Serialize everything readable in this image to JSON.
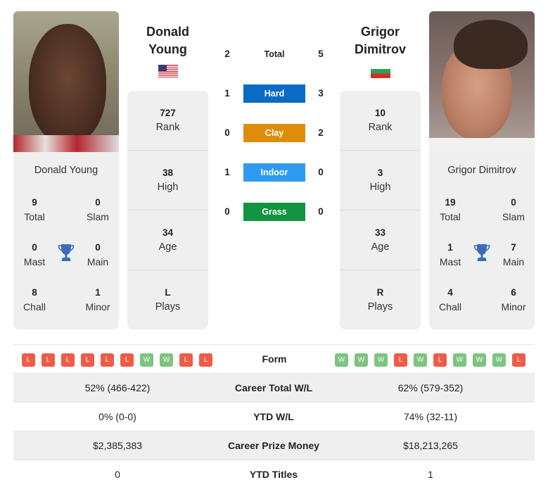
{
  "players": {
    "left": {
      "name": "Donald Young",
      "first": "Donald",
      "last": "Young",
      "country_flag": "us-flag",
      "rank": "727",
      "rank_label": "Rank",
      "high": "38",
      "high_label": "High",
      "age": "34",
      "age_label": "Age",
      "plays": "L",
      "plays_label": "Plays",
      "titles": {
        "total": "9",
        "total_label": "Total",
        "slam": "0",
        "slam_label": "Slam",
        "mast": "0",
        "mast_label": "Mast",
        "main": "0",
        "main_label": "Main",
        "chall": "8",
        "chall_label": "Chall",
        "minor": "1",
        "minor_label": "Minor"
      }
    },
    "right": {
      "name": "Grigor Dimitrov",
      "first": "Grigor",
      "last": "Dimitrov",
      "country_flag": "bulgaria-flag",
      "rank": "10",
      "rank_label": "Rank",
      "high": "3",
      "high_label": "High",
      "age": "33",
      "age_label": "Age",
      "plays": "R",
      "plays_label": "Plays",
      "titles": {
        "total": "19",
        "total_label": "Total",
        "slam": "0",
        "slam_label": "Slam",
        "mast": "1",
        "mast_label": "Mast",
        "main": "7",
        "main_label": "Main",
        "chall": "4",
        "chall_label": "Chall",
        "minor": "6",
        "minor_label": "Minor"
      }
    }
  },
  "h2h": [
    {
      "label": "Total",
      "left": "2",
      "right": "5",
      "color": ""
    },
    {
      "label": "Hard",
      "left": "1",
      "right": "3",
      "color": "#0a6bc2"
    },
    {
      "label": "Clay",
      "left": "0",
      "right": "2",
      "color": "#e08c0b"
    },
    {
      "label": "Indoor",
      "left": "1",
      "right": "0",
      "color": "#2e9bf0"
    },
    {
      "label": "Grass",
      "left": "0",
      "right": "0",
      "color": "#129440"
    }
  ],
  "form": {
    "label": "Form",
    "left": [
      "L",
      "L",
      "L",
      "L",
      "L",
      "L",
      "W",
      "W",
      "L",
      "L"
    ],
    "right": [
      "W",
      "W",
      "W",
      "L",
      "W",
      "L",
      "W",
      "W",
      "W",
      "L"
    ]
  },
  "comparison": [
    {
      "label": "Career Total W/L",
      "left": "52% (466-422)",
      "right": "62% (579-352)"
    },
    {
      "label": "YTD W/L",
      "left": "0% (0-0)",
      "right": "74% (32-11)"
    },
    {
      "label": "Career Prize Money",
      "left": "$2,385,383",
      "right": "$18,213,265"
    },
    {
      "label": "YTD Titles",
      "left": "0",
      "right": "1"
    }
  ]
}
